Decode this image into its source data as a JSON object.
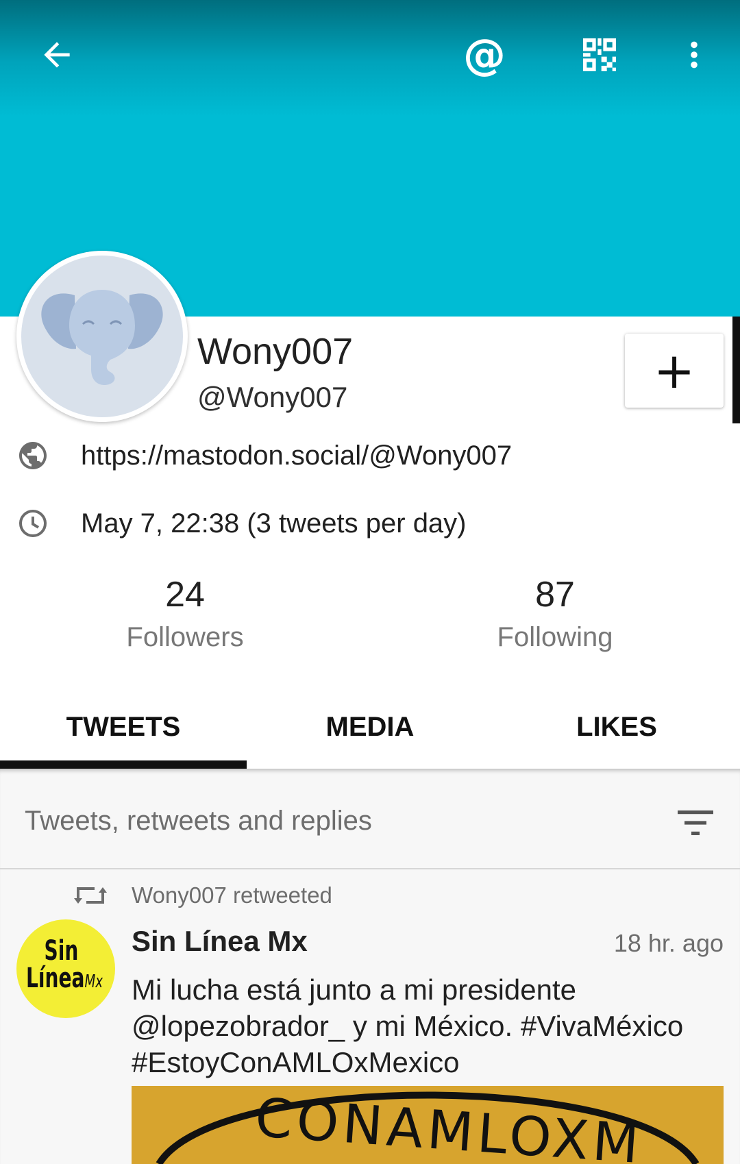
{
  "colors": {
    "banner": "#00bcd4",
    "accent_dark": "#111111",
    "secondary_text": "#777777",
    "post_avatar_bg": "#f3ee35",
    "media_bg": "#d7a42e"
  },
  "topbar": {
    "icons": [
      "back-arrow-icon",
      "mention-icon",
      "qr-code-icon",
      "more-vert-icon"
    ],
    "mention_glyph": "@"
  },
  "profile": {
    "display_name": "Wony007",
    "handle": "@Wony007",
    "website": "https://mastodon.social/@Wony007",
    "joined": "May 7, 22:38 (3 tweets per day)",
    "follow_glyph": "+",
    "avatar_icon": "elephant-avatar-icon"
  },
  "stats": {
    "followers": {
      "count": "24",
      "label": "Followers"
    },
    "following": {
      "count": "87",
      "label": "Following"
    }
  },
  "tabs": [
    {
      "label": "TWEETS",
      "selected": true
    },
    {
      "label": "MEDIA",
      "selected": false
    },
    {
      "label": "LIKES",
      "selected": false
    }
  ],
  "feed": {
    "filter_label": "Tweets, retweets and replies",
    "filter_icon": "filter-icon",
    "posts": [
      {
        "retweeted_by": "Wony007 retweeted",
        "author": "Sin Línea Mx",
        "time": "18 hr. ago",
        "text": "Mi lucha está junto a mi presidente @lopezobrador_ y mi México. #VivaMéxico #EstoyConAMLOxMexico",
        "avatar_logo": {
          "line1": "Sin",
          "line2": "Línea",
          "suffix": "Mx"
        },
        "media_text": "CONAMLOXM"
      }
    ]
  }
}
